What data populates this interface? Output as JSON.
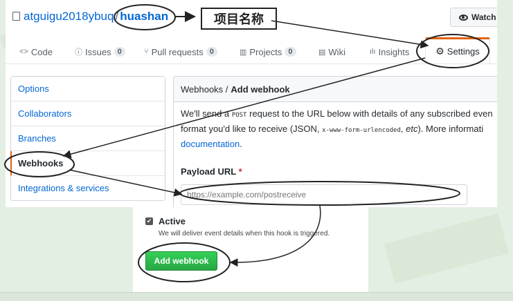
{
  "repo": {
    "owner": "atguigu2018ybuq",
    "separator": "/",
    "name": "huashan"
  },
  "annotation": {
    "project_name_label": "项目名称"
  },
  "watch_button": {
    "label": "Watch"
  },
  "tabs": [
    {
      "label": "Code",
      "icon": "code-icon"
    },
    {
      "label": "Issues",
      "count": "0",
      "icon": "issue-icon"
    },
    {
      "label": "Pull requests",
      "count": "0",
      "icon": "pull-request-icon"
    },
    {
      "label": "Projects",
      "count": "0",
      "icon": "project-icon"
    },
    {
      "label": "Wiki",
      "icon": "book-icon"
    },
    {
      "label": "Insights",
      "icon": "graph-icon"
    },
    {
      "label": "Settings",
      "icon": "gear-icon"
    }
  ],
  "sidebar": {
    "items": [
      {
        "label": "Options"
      },
      {
        "label": "Collaborators"
      },
      {
        "label": "Branches"
      },
      {
        "label": "Webhooks",
        "selected": true
      },
      {
        "label": "Integrations & services"
      }
    ]
  },
  "webhook": {
    "breadcrumb_parent": "Webhooks /",
    "breadcrumb_current": "Add webhook",
    "desc_part1": "We'll send a",
    "desc_code1": "POST",
    "desc_part2": "request to the URL below with details of any subscribed even",
    "desc_part3": "format you'd like to receive (JSON,",
    "desc_code2": "x-www-form-urlencoded",
    "desc_part4": ",",
    "desc_etc": "etc",
    "desc_part5": "). More informati",
    "desc_link": "documentation",
    "desc_end": ".",
    "payload_label": "Payload URL",
    "required_mark": "*",
    "payload_placeholder": "https://example.com/postreceive"
  },
  "active": {
    "label": "Active",
    "note": "We will deliver event details when this hook is triggered.",
    "checked": true
  },
  "add_button": {
    "label": "Add webhook"
  },
  "colors": {
    "accent": "#e36209",
    "link": "#0366d6",
    "button_green": "#28a745"
  }
}
